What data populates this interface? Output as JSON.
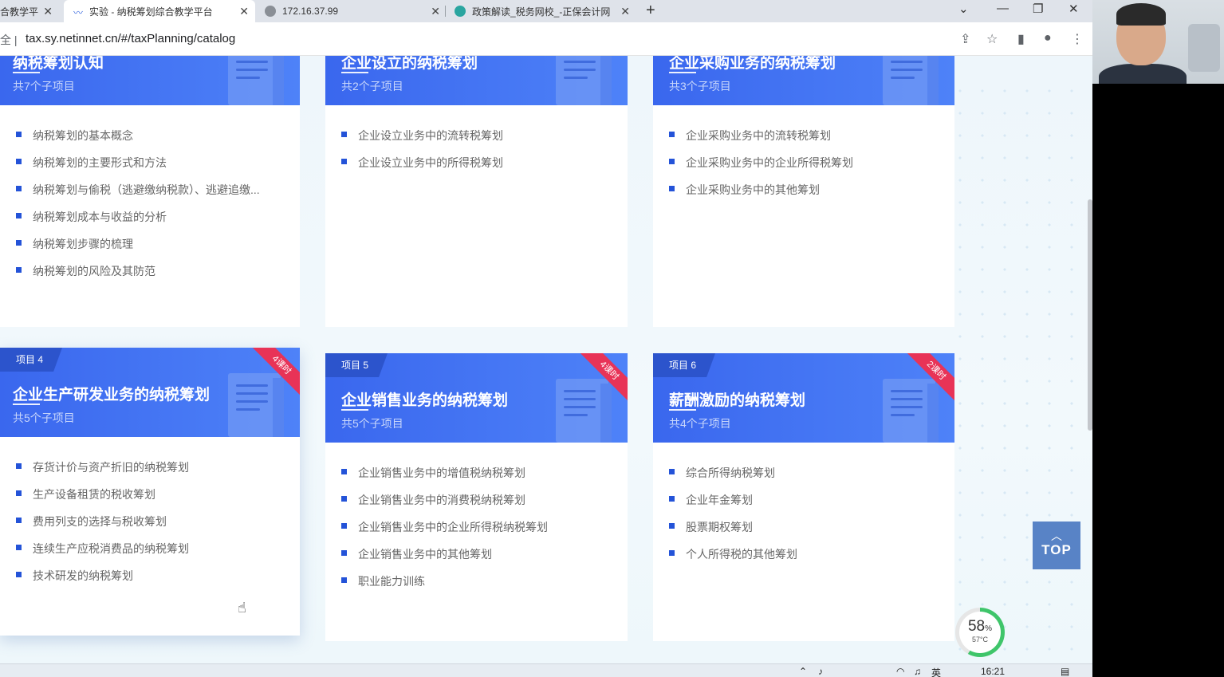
{
  "browser": {
    "tabs": [
      {
        "title": "合教学平",
        "icon_color": "#1a73e8"
      },
      {
        "title": "实验 - 纳税筹划综合教学平台",
        "icon_color": "#3b6be0"
      },
      {
        "title": "172.16.37.99",
        "icon_color": "#5f6368"
      },
      {
        "title": "政策解读_税务网校_-正保会计网",
        "icon_color": "#2aa5a0"
      }
    ],
    "new_tab": "+",
    "address_prefix": "全 |",
    "url": "tax.sy.netinnet.cn/#/taxPlanning/catalog"
  },
  "cards": [
    {
      "tag": "",
      "title": "纳税筹划认知",
      "subtitle": "共7个子项目",
      "ribbon": "",
      "items": [
        "纳税筹划的基本概念",
        "纳税筹划的主要形式和方法",
        "纳税筹划与偷税（逃避缴纳税款）、逃避追缴...",
        "纳税筹划成本与收益的分析",
        "纳税筹划步骤的梳理",
        "纳税筹划的风险及其防范"
      ]
    },
    {
      "tag": "",
      "title": "企业设立的纳税筹划",
      "subtitle": "共2个子项目",
      "ribbon": "",
      "items": [
        "企业设立业务中的流转税筹划",
        "企业设立业务中的所得税筹划"
      ]
    },
    {
      "tag": "",
      "title": "企业采购业务的纳税筹划",
      "subtitle": "共3个子项目",
      "ribbon": "",
      "items": [
        "企业采购业务中的流转税筹划",
        "企业采购业务中的企业所得税筹划",
        "企业采购业务中的其他筹划"
      ]
    },
    {
      "tag": "项目 4",
      "title": "企业生产研发业务的纳税筹划",
      "subtitle": "共5个子项目",
      "ribbon": "4课时",
      "items": [
        "存货计价与资产折旧的纳税筹划",
        "生产设备租赁的税收筹划",
        "费用列支的选择与税收筹划",
        "连续生产应税消费品的纳税筹划",
        "技术研发的纳税筹划"
      ]
    },
    {
      "tag": "项目 5",
      "title": "企业销售业务的纳税筹划",
      "subtitle": "共5个子项目",
      "ribbon": "4课时",
      "items": [
        "企业销售业务中的增值税纳税筹划",
        "企业销售业务中的消费税纳税筹划",
        "企业销售业务中的企业所得税纳税筹划",
        "企业销售业务中的其他筹划",
        "职业能力训练"
      ]
    },
    {
      "tag": "项目 6",
      "title": "薪酬激励的纳税筹划",
      "subtitle": "共4个子项目",
      "ribbon": "2课时",
      "items": [
        "综合所得纳税筹划",
        "企业年金筹划",
        "股票期权筹划",
        "个人所得税的其他筹划"
      ]
    }
  ],
  "top_button": {
    "label": "TOP"
  },
  "gauge": {
    "percent": 58,
    "percent_label": "58",
    "unit": "%",
    "temp": "57°C"
  },
  "taskbar": {
    "ime": "英",
    "time": "16:21"
  },
  "colors": {
    "header": "#3a67ee",
    "ribbon": "#e83357",
    "bullet": "#2453d8"
  }
}
